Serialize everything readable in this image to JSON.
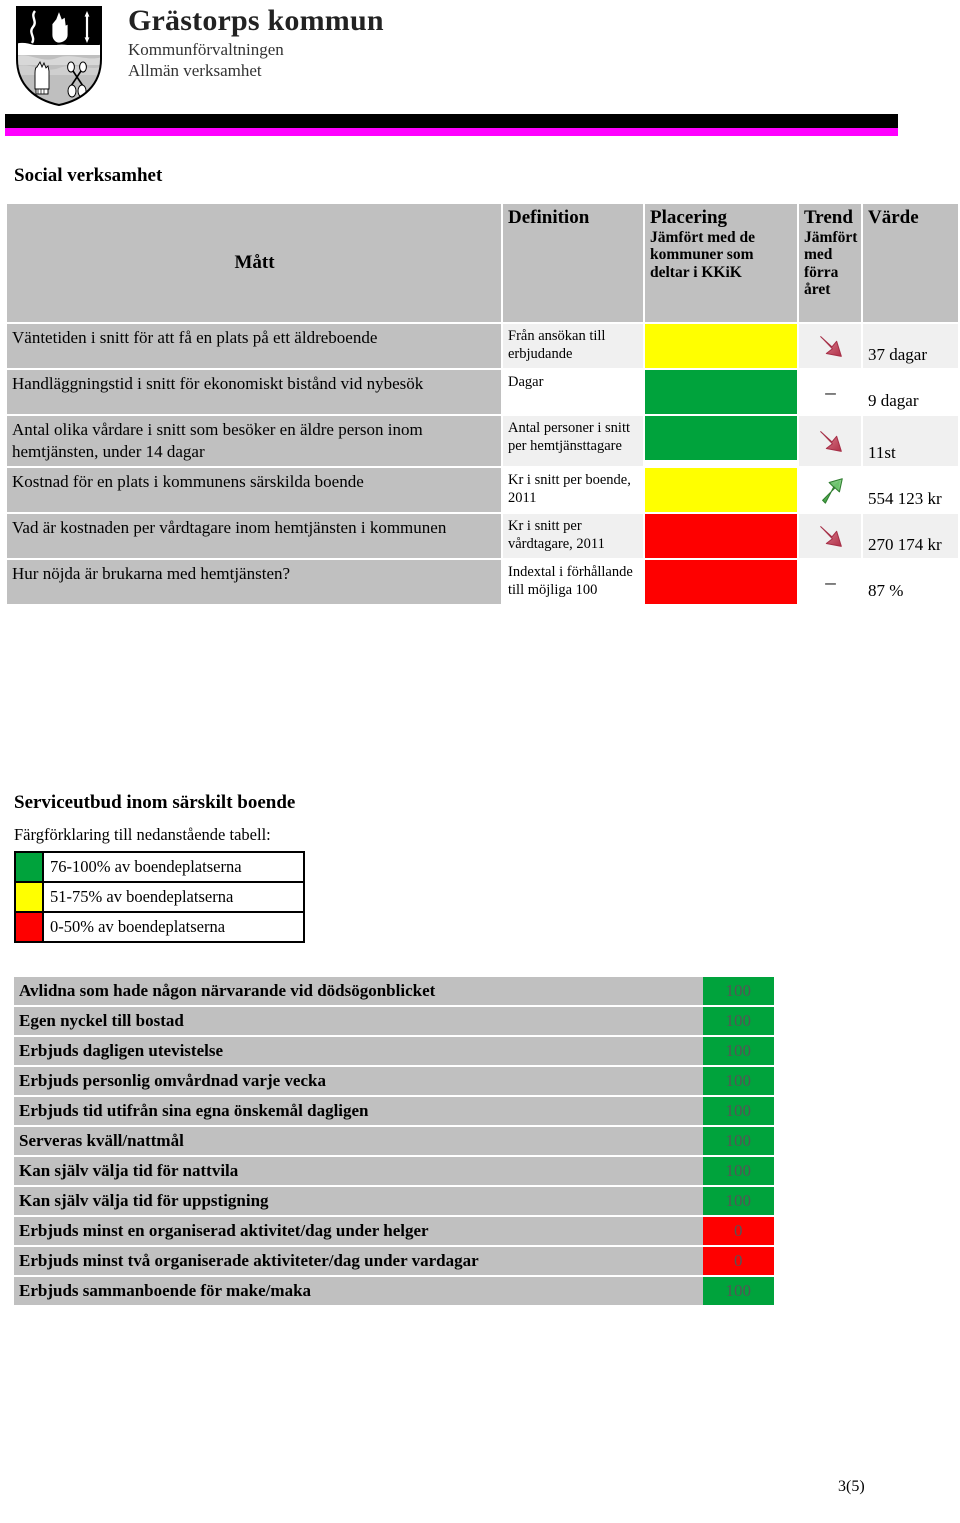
{
  "header": {
    "org_name": "Grästorps kommun",
    "org_line1": "Kommunförvaltningen",
    "org_line2": "Allmän verksamhet",
    "crest_icon": "coat-of-arms-icon"
  },
  "sections": {
    "social": "Social verksamhet",
    "service": "Serviceutbud inom särskilt boende"
  },
  "kkik_table": {
    "headers": {
      "matt": "Mått",
      "definition": "Definition",
      "placering_main": "Placering",
      "placering_sub": "Jämfört med de kommuner som deltar i KKiK",
      "trend_main": "Trend",
      "trend_sub": "Jämfört med förra året",
      "varde": "Värde"
    },
    "rows": [
      {
        "matt": "Väntetiden i snitt för att få en plats på ett äldreboende",
        "definition": "Från ansökan till erbjudande",
        "placering_color": "#ffff00",
        "trend": "down",
        "varde": "37 dagar"
      },
      {
        "matt": "Handläggningstid i snitt för ekonomiskt bistånd vid nybesök",
        "definition": "Dagar",
        "placering_color": "#00a33c",
        "trend": "flat",
        "varde": "9 dagar"
      },
      {
        "matt": "Antal olika vårdare i snitt som besöker en äldre person inom hemtjänsten, under 14 dagar",
        "definition": "Antal personer i snitt per hemtjänsttagare",
        "placering_color": "#00a33c",
        "trend": "down",
        "varde": "11st"
      },
      {
        "matt": "Kostnad för en plats i kommunens särskilda boende",
        "definition": "Kr i snitt per boende, 2011",
        "placering_color": "#ffff00",
        "trend": "up",
        "varde": "554 123 kr"
      },
      {
        "matt": "Vad är kostnaden per vårdtagare inom hemtjänsten i kommunen",
        "definition": "Kr i snitt per vårdtagare, 2011",
        "placering_color": "#fe0000",
        "trend": "down",
        "varde": "270 174 kr"
      },
      {
        "matt": "Hur nöjda är brukarna med hemtjänsten?",
        "definition": "Indextal i förhållande till möjliga 100",
        "placering_color": "#fe0000",
        "trend": "flat",
        "varde": "87 %"
      }
    ]
  },
  "legend": {
    "title": "Färgförklaring till nedanstående tabell:",
    "items": [
      {
        "color": "#00a33c",
        "label": "76-100% av boendeplatserna"
      },
      {
        "color": "#ffff00",
        "label": "51-75% av boendeplatserna"
      },
      {
        "color": "#fe0000",
        "label": "0-50% av boendeplatserna"
      }
    ]
  },
  "service_table": {
    "rows": [
      {
        "name": "Avlidna som hade någon närvarande vid dödsögonblicket",
        "value": "100",
        "color": "#00a33c"
      },
      {
        "name": "Egen nyckel  till bostad",
        "value": "100",
        "color": "#00a33c"
      },
      {
        "name": "Erbjuds dagligen utevistelse",
        "value": "100",
        "color": "#00a33c"
      },
      {
        "name": "Erbjuds personlig omvårdnad varje vecka",
        "value": "100",
        "color": "#00a33c"
      },
      {
        "name": "Erbjuds tid utifrån sina egna önskemål dagligen",
        "value": "100",
        "color": "#00a33c"
      },
      {
        "name": "Serveras kväll/nattmål",
        "value": "100",
        "color": "#00a33c"
      },
      {
        "name": "Kan själv välja tid för nattvila",
        "value": "100",
        "color": "#00a33c"
      },
      {
        "name": "Kan själv välja tid för uppstigning",
        "value": "100",
        "color": "#00a33c"
      },
      {
        "name": "Erbjuds minst en organiserad aktivitet/dag under helger",
        "value": "0",
        "color": "#fe0000"
      },
      {
        "name": "Erbjuds minst två organiserade aktiviteter/dag under vardagar",
        "value": "0",
        "color": "#fe0000"
      },
      {
        "name": "Erbjuds sammanboende för make/maka",
        "value": "100",
        "color": "#00a33c"
      }
    ]
  },
  "footer": {
    "page": "3(5)"
  },
  "colors": {
    "green": "#00a33c",
    "yellow": "#ffff00",
    "red": "#fe0000",
    "magenta_rule": "#ff00ff",
    "header_gray": "#c0c0c0"
  }
}
